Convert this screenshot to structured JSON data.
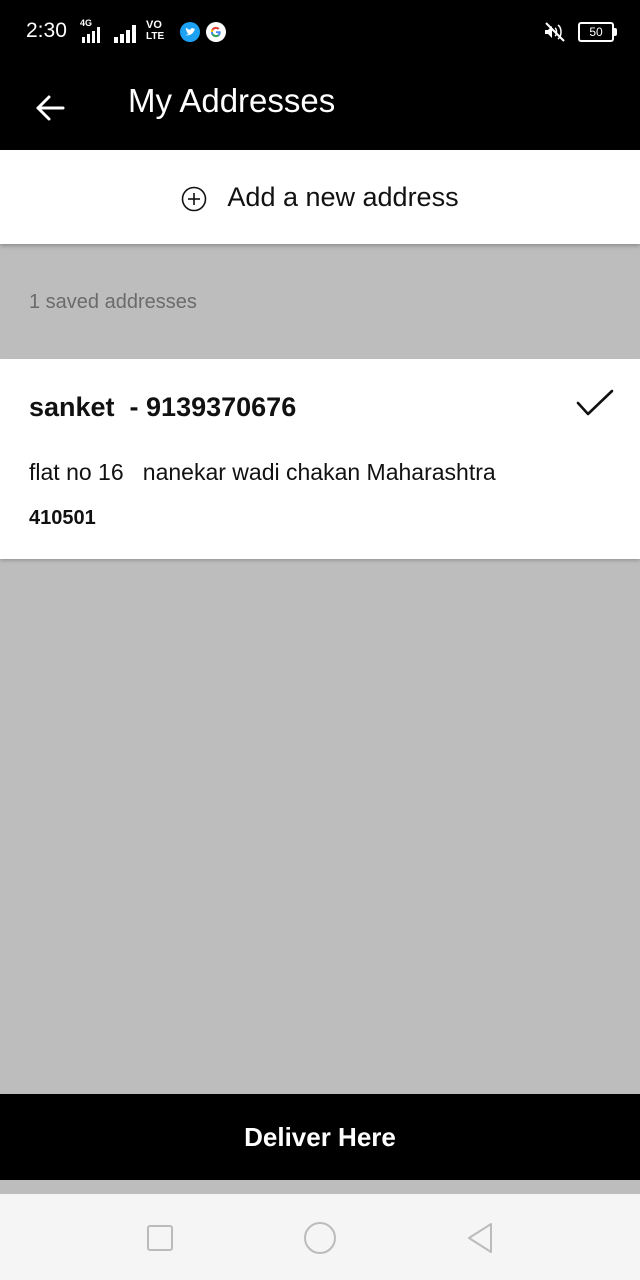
{
  "status_bar": {
    "time": "2:30",
    "network_type": "4G",
    "volte_label_top": "VO",
    "volte_label_bottom": "LTE",
    "battery_level": "50",
    "icons": [
      "signal-4g-icon",
      "signal-icon",
      "volte-icon",
      "twitter-icon",
      "google-icon",
      "silent-bell-icon",
      "battery-icon"
    ]
  },
  "app_bar": {
    "title": "My Addresses",
    "back_icon": "arrow-left-icon"
  },
  "add_address": {
    "label": "Add a new address",
    "icon": "plus-circle-icon"
  },
  "saved": {
    "count_text": "1 saved addresses"
  },
  "addresses": [
    {
      "name_phone": "sanket  - 9139370676",
      "line": "flat no 16   nanekar wadi chakan Maharashtra",
      "pincode": "410501",
      "selected": true,
      "check_icon": "checkmark-icon"
    }
  ],
  "footer": {
    "deliver_label": "Deliver Here"
  },
  "nav_bar": {
    "icons": [
      "recents-square-icon",
      "home-circle-icon",
      "back-triangle-icon"
    ]
  },
  "colors": {
    "bar_black": "#000000",
    "background_grey": "#bdbdbd",
    "card_white": "#ffffff",
    "muted_text": "#6b6b6b",
    "twitter_blue": "#1da1f2"
  }
}
